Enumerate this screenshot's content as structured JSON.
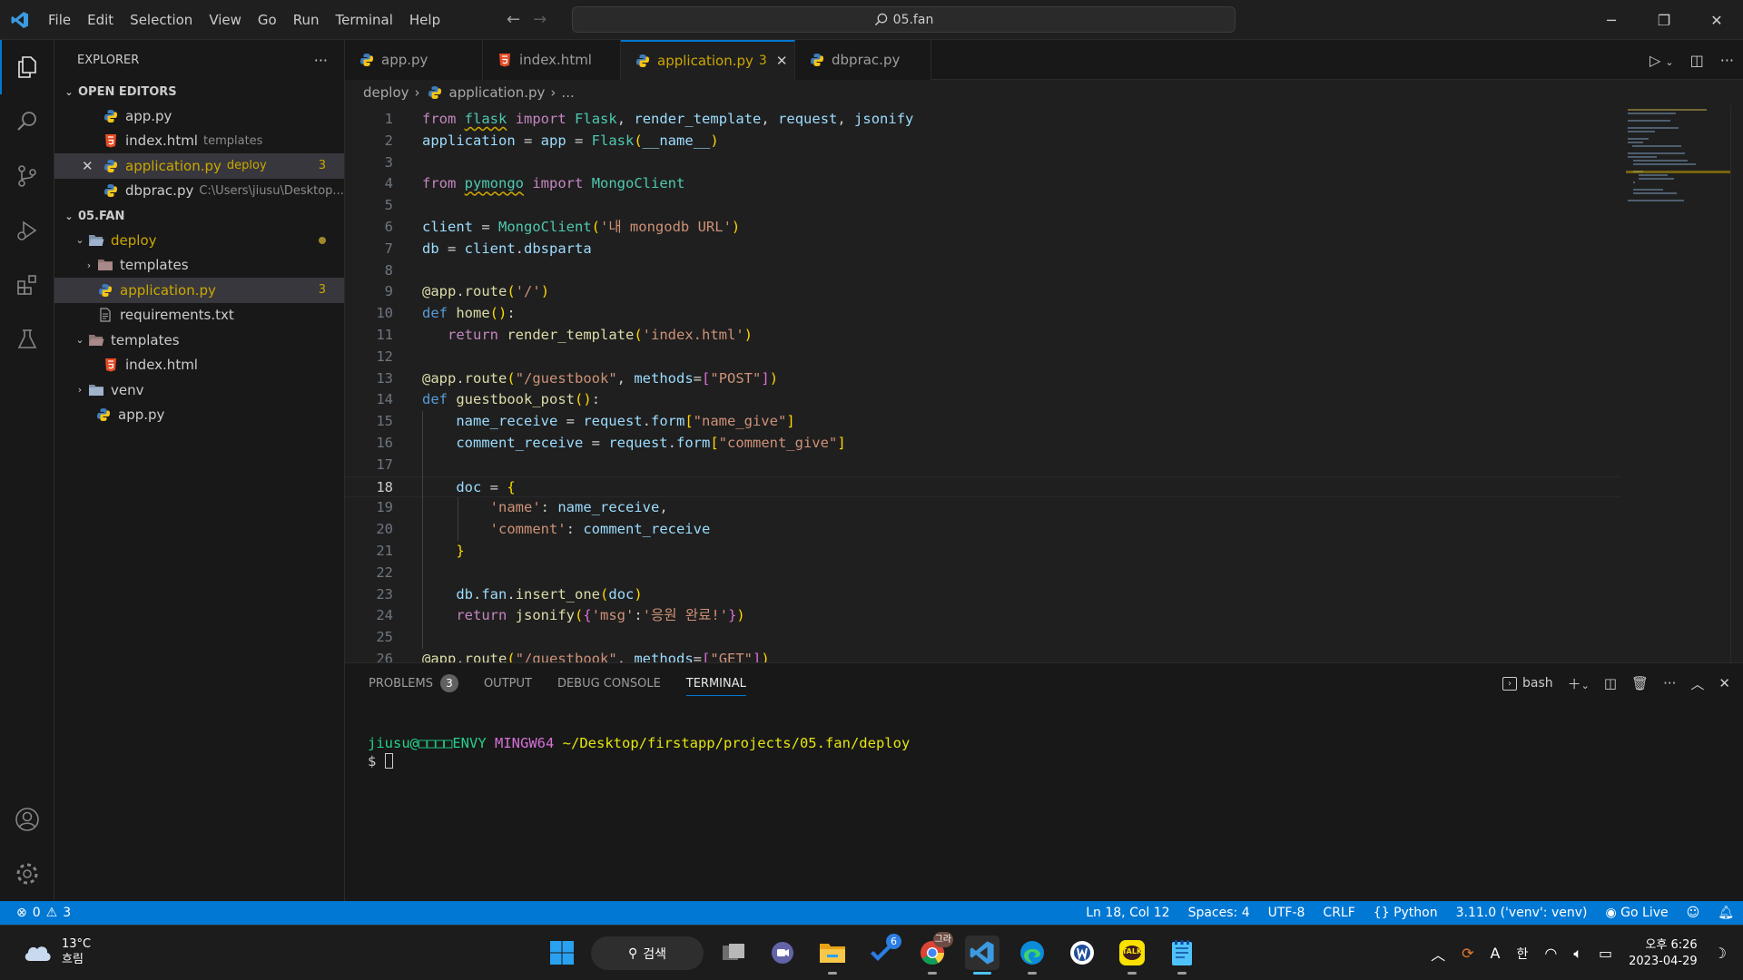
{
  "titlebar": {
    "menu": [
      "File",
      "Edit",
      "Selection",
      "View",
      "Go",
      "Run",
      "Terminal",
      "Help"
    ],
    "command_center": "05.fan",
    "icons": [
      "vscode-logo-icon",
      "back-arrow-icon",
      "forward-arrow-icon",
      "minimize-icon",
      "restore-icon",
      "close-icon"
    ]
  },
  "activitybar": {
    "items": [
      "explorer-icon",
      "search-icon",
      "source-control-icon",
      "run-debug-icon",
      "extensions-icon",
      "testing-icon"
    ],
    "bottom": [
      "account-icon",
      "manage-gear-icon"
    ]
  },
  "sidebar": {
    "title": "EXPLORER",
    "more": "···",
    "open_editors": {
      "header": "OPEN EDITORS",
      "items": [
        {
          "name": "app.py",
          "desc": "",
          "type": "python",
          "badge": ""
        },
        {
          "name": "index.html",
          "desc": "templates",
          "type": "html",
          "badge": ""
        },
        {
          "name": "application.py",
          "desc": "deploy",
          "type": "python",
          "badge": "3"
        },
        {
          "name": "dbprac.py",
          "desc": "C:\\Users\\jiusu\\Desktop...",
          "type": "python",
          "badge": ""
        }
      ]
    },
    "workspace": {
      "header": "05.FAN",
      "items": [
        {
          "name": "deploy",
          "type": "folder-open",
          "depth": 1
        },
        {
          "name": "templates",
          "type": "folder",
          "depth": 2
        },
        {
          "name": "application.py",
          "type": "python",
          "depth": 2,
          "badge": "3"
        },
        {
          "name": "requirements.txt",
          "type": "text",
          "depth": 2
        },
        {
          "name": "templates",
          "type": "folder-open",
          "depth": 1
        },
        {
          "name": "index.html",
          "type": "html",
          "depth": 2
        },
        {
          "name": "venv",
          "type": "folder",
          "depth": 1
        },
        {
          "name": "app.py",
          "type": "python",
          "depth": 1
        }
      ]
    }
  },
  "tabs": [
    {
      "label": "app.py",
      "type": "python"
    },
    {
      "label": "index.html",
      "type": "html"
    },
    {
      "label": "application.py",
      "type": "python",
      "count": "3",
      "active": true
    },
    {
      "label": "dbprac.py",
      "type": "python"
    }
  ],
  "breadcrumb": [
    "deploy",
    "application.py",
    "..."
  ],
  "editor": {
    "current_line": 18,
    "line_numbers": [
      "1",
      "2",
      "3",
      "4",
      "5",
      "6",
      "7",
      "8",
      "9",
      "10",
      "11",
      "12",
      "13",
      "14",
      "15",
      "16",
      "17",
      "18",
      "19",
      "20",
      "21",
      "22",
      "23",
      "24",
      "25",
      "26"
    ],
    "lines": [
      "from flask import Flask, render_template, request, jsonify",
      "application = app = Flask(__name__)",
      "",
      "from pymongo import MongoClient",
      "",
      "client = MongoClient('내 mongodb URL')",
      "db = client.dbsparta",
      "",
      "@app.route('/')",
      "def home():",
      "   return render_template('index.html')",
      "",
      "@app.route(\"/guestbook\", methods=[\"POST\"])",
      "def guestbook_post():",
      "    name_receive = request.form[\"name_give\"]",
      "    comment_receive = request.form[\"comment_give\"]",
      "",
      "    doc = {",
      "        'name': name_receive,",
      "        'comment': comment_receive",
      "    }",
      "",
      "    db.fan.insert_one(doc)",
      "    return jsonify({'msg':'응원 완료!'})",
      "",
      "@app.route(\"/guestbook\", methods=[\"GET\"])"
    ]
  },
  "panel": {
    "tabs": [
      {
        "label": "PROBLEMS",
        "count": "3"
      },
      {
        "label": "OUTPUT"
      },
      {
        "label": "DEBUG CONSOLE"
      },
      {
        "label": "TERMINAL",
        "active": true
      }
    ],
    "shell": "bash",
    "terminal": {
      "user_host": "jiusu@□□□□ENVY",
      "env": "MINGW64",
      "path": "~/Desktop/firstapp/projects/05.fan/deploy",
      "prompt": "$ "
    }
  },
  "statusbar": {
    "errors": "0",
    "warnings": "3",
    "position": "Ln 18, Col 12",
    "spaces": "Spaces: 4",
    "encoding": "UTF-8",
    "eol": "CRLF",
    "language": "Python",
    "interpreter": "3.11.0 ('venv': venv)",
    "golive": "Go Live"
  },
  "taskbar": {
    "weather_temp": "13°C",
    "weather_desc": "흐림",
    "search": "검색",
    "apps": [
      "windows-start-icon",
      "task-view-icon",
      "teams-chat-icon",
      "file-explorer-icon",
      "todo-icon",
      "chrome-icon",
      "vscode-icon",
      "edge-icon",
      "word-icon",
      "kakaotalk-icon",
      "notepad-icon"
    ],
    "todo_badge": "6",
    "chrome_badge": "그라",
    "kakaotalk_label": "TALK",
    "ime_mode": "A",
    "ime_lang": "한",
    "time": "오후 6:26",
    "date": "2023-04-29"
  },
  "colors": {
    "accent": "#0078d4",
    "warning": "#cca700",
    "editor_bg": "#1f1f1f",
    "sidebar_bg": "#181818"
  }
}
